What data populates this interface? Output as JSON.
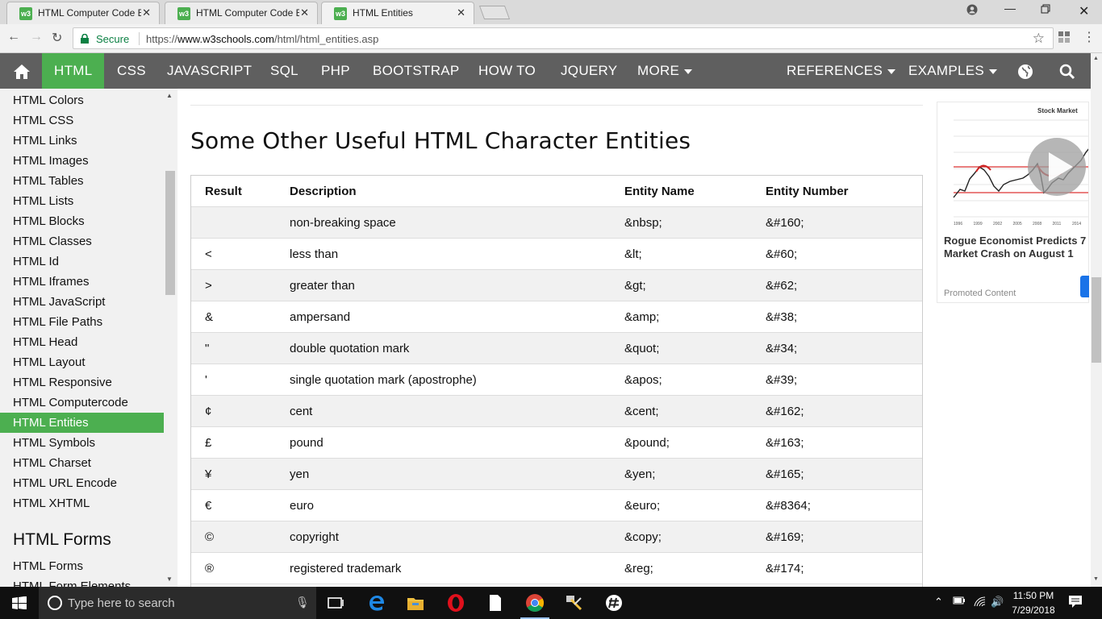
{
  "browser": {
    "tabs": [
      {
        "title": "HTML Computer Code Ele",
        "active": false
      },
      {
        "title": "HTML Computer Code Ele",
        "active": false
      },
      {
        "title": "HTML Entities",
        "active": true
      }
    ],
    "tab_favicon": "w3",
    "secure_label": "Secure",
    "url_prefix": "https://",
    "url_domain": "www.w3schools.com",
    "url_path": "/html/html_entities.asp"
  },
  "topnav": {
    "items": [
      "HTML",
      "CSS",
      "JAVASCRIPT",
      "SQL",
      "PHP",
      "BOOTSTRAP",
      "HOW TO",
      "JQUERY",
      "MORE"
    ],
    "active": "HTML",
    "references": "REFERENCES",
    "examples": "EXAMPLES"
  },
  "sidebar": {
    "items": [
      "HTML Colors",
      "HTML CSS",
      "HTML Links",
      "HTML Images",
      "HTML Tables",
      "HTML Lists",
      "HTML Blocks",
      "HTML Classes",
      "HTML Id",
      "HTML Iframes",
      "HTML JavaScript",
      "HTML File Paths",
      "HTML Head",
      "HTML Layout",
      "HTML Responsive",
      "HTML Computercode",
      "HTML Entities",
      "HTML Symbols",
      "HTML Charset",
      "HTML URL Encode",
      "HTML XHTML"
    ],
    "active": "HTML Entities",
    "section_heading": "HTML Forms",
    "section_items": [
      "HTML Forms",
      "HTML Form Elements"
    ]
  },
  "main": {
    "heading": "Some Other Useful HTML Character Entities",
    "table": {
      "headers": [
        "Result",
        "Description",
        "Entity Name",
        "Entity Number"
      ],
      "rows": [
        [
          "",
          "non-breaking space",
          "&nbsp;",
          "&#160;"
        ],
        [
          "<",
          "less than",
          "&lt;",
          "&#60;"
        ],
        [
          ">",
          "greater than",
          "&gt;",
          "&#62;"
        ],
        [
          "&",
          "ampersand",
          "&amp;",
          "&#38;"
        ],
        [
          "\"",
          "double quotation mark",
          "&quot;",
          "&#34;"
        ],
        [
          "'",
          "single quotation mark (apostrophe)",
          "&apos;",
          "&#39;"
        ],
        [
          "¢",
          "cent",
          "&cent;",
          "&#162;"
        ],
        [
          "£",
          "pound",
          "&pound;",
          "&#163;"
        ],
        [
          "¥",
          "yen",
          "&yen;",
          "&#165;"
        ],
        [
          "€",
          "euro",
          "&euro;",
          "&#8364;"
        ],
        [
          "©",
          "copyright",
          "&copy;",
          "&#169;"
        ],
        [
          "®",
          "registered trademark",
          "&reg;",
          "&#174;"
        ]
      ]
    }
  },
  "ad": {
    "chart_title": "Stock Market",
    "year_labels": [
      "1996",
      "1999",
      "2002",
      "2005",
      "2008",
      "2011",
      "2014"
    ],
    "headline": "Rogue Economist Predicts 7 Market Crash on August 1",
    "promoted": "Promoted Content"
  },
  "taskbar": {
    "search_placeholder": "Type here to search",
    "time": "11:50 PM",
    "date": "7/29/2018"
  },
  "colors": {
    "accent": "#4caf50",
    "nav_bg": "#5f5f5f",
    "sidebar_bg": "#f1f1f1"
  }
}
